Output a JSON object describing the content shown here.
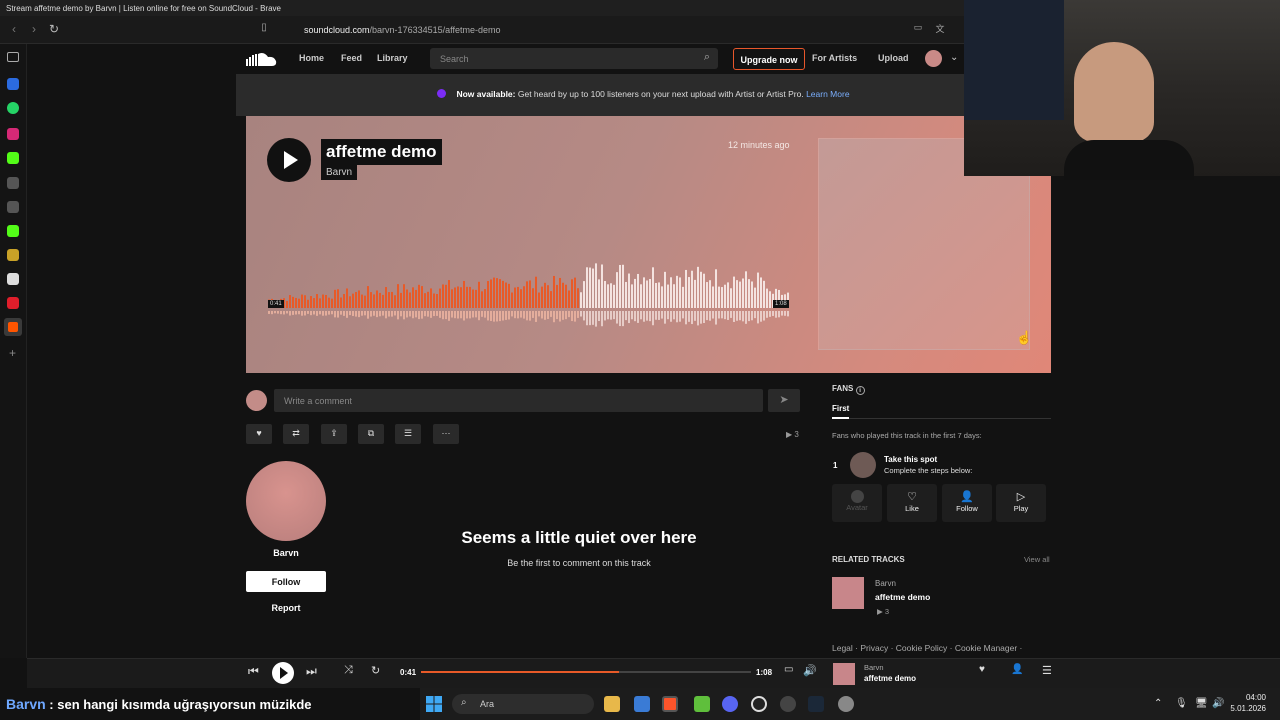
{
  "window": {
    "title": "Stream affetme demo by Barvn | Listen online for free on SoundCloud - Brave"
  },
  "browser": {
    "url_host": "soundcloud.com",
    "url_path": "/barvn-176334515/affetme-demo"
  },
  "nav": {
    "home": "Home",
    "feed": "Feed",
    "library": "Library",
    "search_placeholder": "Search",
    "upgrade": "Upgrade now",
    "for_artists": "For Artists",
    "upload": "Upload"
  },
  "banner": {
    "bold": "Now available:",
    "text": " Get heard by up to 100 listeners on your next upload with Artist or Artist Pro. ",
    "link": "Learn More"
  },
  "track": {
    "title": "affetme demo",
    "artist": "Barvn",
    "posted": "12 minutes ago",
    "elapsed": "0:41",
    "duration": "1:08",
    "progress": 0.6
  },
  "comment": {
    "placeholder": "Write a comment"
  },
  "actions": {
    "plays": "3"
  },
  "uploader": {
    "name": "Barvn",
    "follow": "Follow",
    "report": "Report"
  },
  "empty_state": {
    "title": "Seems a little quiet over here",
    "subtitle": "Be the first to comment on this track"
  },
  "fans": {
    "header": "FANS",
    "tab": "First",
    "description": "Fans who played this track in the first 7 days:",
    "rank": "1",
    "spot_title": "Take this spot",
    "spot_sub": "Complete the steps below:",
    "steps": [
      "Avatar",
      "Like",
      "Follow",
      "Play"
    ]
  },
  "related": {
    "header": "RELATED TRACKS",
    "view_all": "View all",
    "artist": "Barvn",
    "title": "affetme demo",
    "plays": "3"
  },
  "legal": {
    "text": "Legal · Privacy · Cookie Policy · Cookie Manager ·"
  },
  "player": {
    "current": "0:41",
    "duration": "1:08",
    "progress": 0.6,
    "artist": "Barvn",
    "title": "affetme demo"
  },
  "chat": {
    "name": "Barvn",
    "message": " : sen hangi kısımda uğraşıyorsun müzikde"
  },
  "taskbar": {
    "search": "Ara",
    "time": "04:00",
    "date": "5.01.2026"
  },
  "colors": {
    "accent": "#e85a28",
    "link": "#7aaefc"
  }
}
